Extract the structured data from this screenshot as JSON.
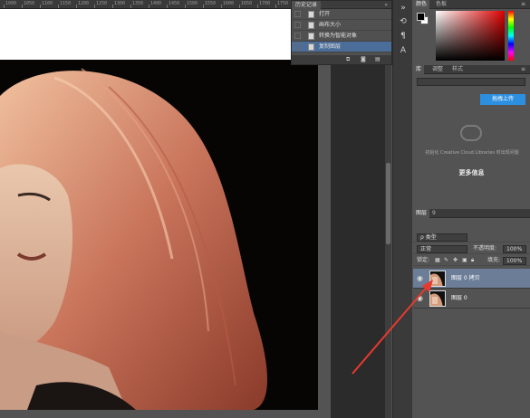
{
  "ruler": {
    "labels": [
      "1000",
      "1050",
      "1100",
      "1150",
      "1200",
      "1250",
      "1300",
      "1350",
      "1400",
      "1450",
      "1500",
      "1550",
      "1600",
      "1650",
      "1700",
      "1750",
      "1800",
      "1850"
    ]
  },
  "history": {
    "title": "历史记录",
    "collapse_icon": "double-chevron-icon",
    "items": [
      {
        "label": "打开",
        "selected": false
      },
      {
        "label": "画布大小",
        "selected": false
      },
      {
        "label": "转换为智能对象",
        "selected": false
      },
      {
        "label": "复制图层",
        "selected": true
      }
    ]
  },
  "color_panel": {
    "tab": "颜色",
    "tab2": "色板",
    "foreground": "#000000",
    "background": "#ffffff",
    "hue": "#e00000"
  },
  "library_panel": {
    "tabs": [
      "库",
      "调整",
      "样式"
    ],
    "upload_button": "拖拽上传",
    "message": "初始化 Creative Cloud Libraries 时出现问题",
    "more_info": "更多信息"
  },
  "layers_panel": {
    "tab": "图层",
    "tab_number": "9",
    "ime_char": "英",
    "filter_type": "类型",
    "blend_mode": "正常",
    "opacity_label": "不透明度:",
    "opacity_value": "100%",
    "lock_label": "锁定:",
    "fill_label": "填充:",
    "fill_value": "100%",
    "layers": [
      {
        "name": "图层 0 拷贝",
        "selected": true,
        "visible": true
      },
      {
        "name": "图层 0",
        "selected": false,
        "visible": true
      }
    ]
  },
  "annotation": {
    "arrow_color": "#e8392f"
  }
}
